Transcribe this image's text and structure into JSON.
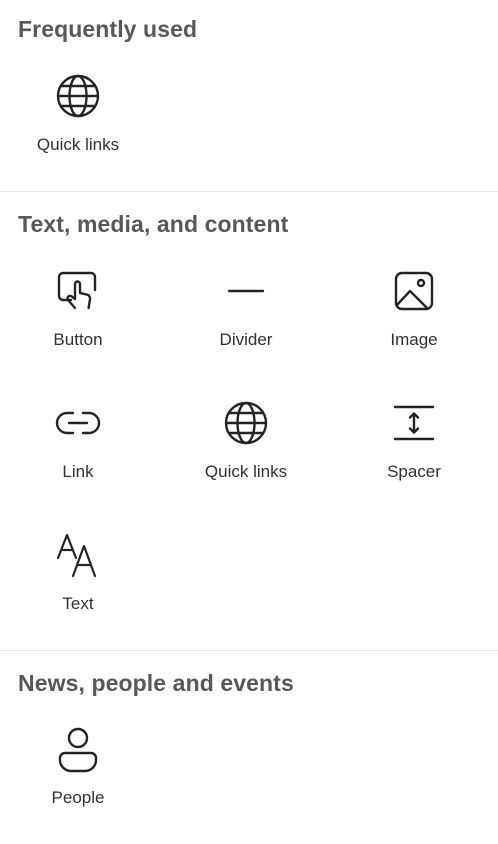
{
  "sections": [
    {
      "title": "Frequently used",
      "items": [
        {
          "label": "Quick links",
          "icon": "globe-icon"
        }
      ]
    },
    {
      "title": "Text, media, and content",
      "items": [
        {
          "label": "Button",
          "icon": "button-touch-icon"
        },
        {
          "label": "Divider",
          "icon": "divider-line-icon"
        },
        {
          "label": "Image",
          "icon": "image-icon"
        },
        {
          "label": "Link",
          "icon": "link-icon"
        },
        {
          "label": "Quick links",
          "icon": "globe-icon"
        },
        {
          "label": "Spacer",
          "icon": "spacer-icon"
        },
        {
          "label": "Text",
          "icon": "text-size-icon"
        }
      ]
    },
    {
      "title": "News, people and events",
      "items": [
        {
          "label": "People",
          "icon": "person-icon"
        }
      ]
    }
  ],
  "colors": {
    "heading": "#5a5855",
    "label": "#323130",
    "icon": "#242424",
    "divider": "#e6e6e6"
  }
}
